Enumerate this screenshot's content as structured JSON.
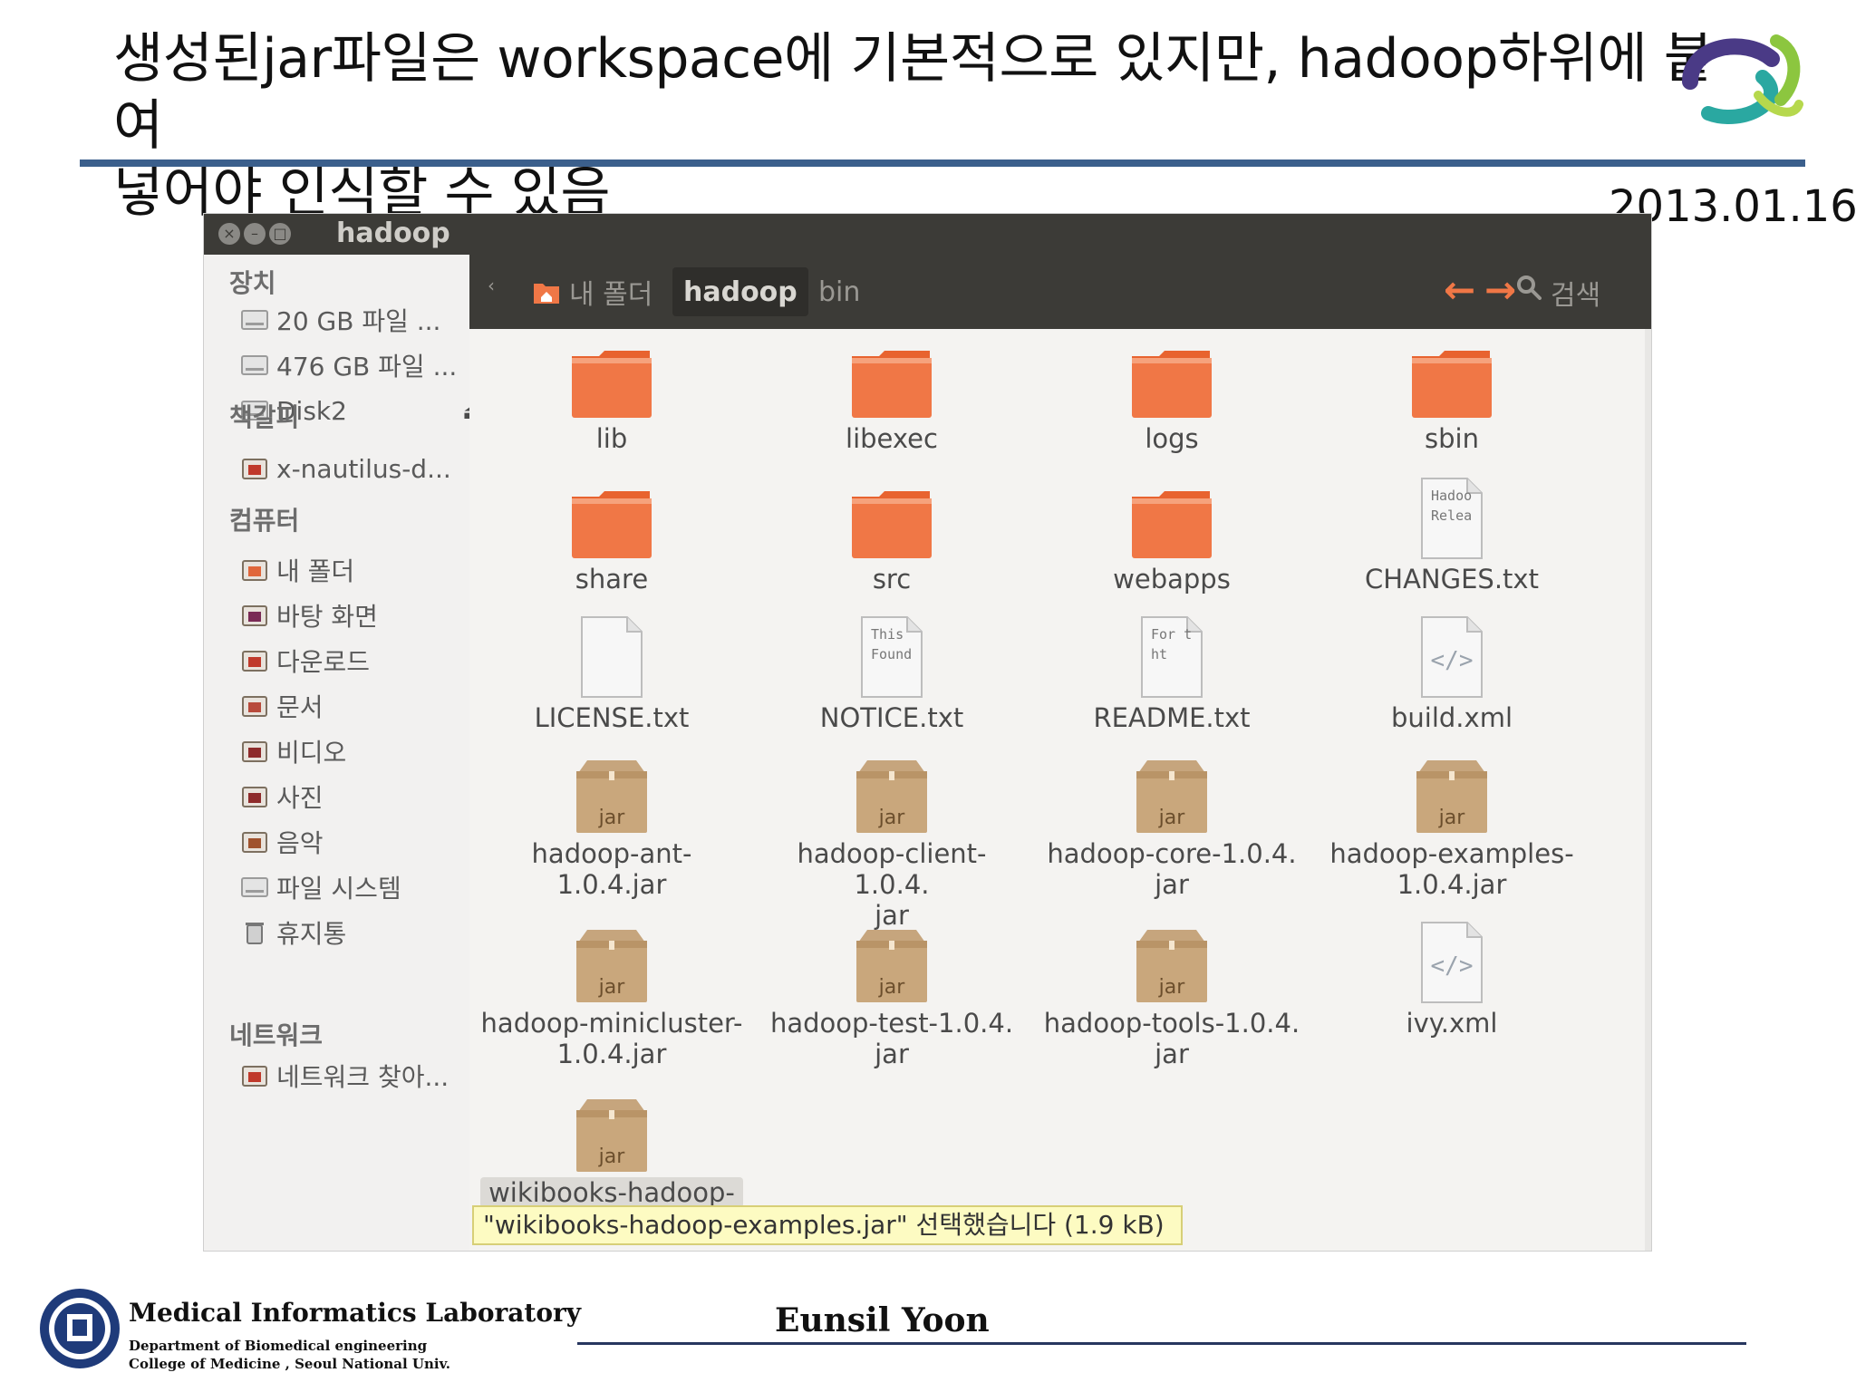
{
  "slide": {
    "title_line1": "생성된jar파일은 workspace에 기본적으로 있지만, hadoop하위에 붙여",
    "title_line2": "넣어야 인식할 수 있음",
    "date": "2013.01.16"
  },
  "window": {
    "title": "hadoop",
    "buttons": [
      "close",
      "minimize",
      "maximize"
    ]
  },
  "toolbar": {
    "breadcrumbs": [
      "내 폴더",
      "hadoop",
      "bin"
    ],
    "active_crumb": "hadoop",
    "back_icon": "arrow-left-icon",
    "forward_icon": "arrow-right-icon",
    "search_label": "검색"
  },
  "sidebar": {
    "sections": [
      {
        "heading": "장치",
        "items": [
          {
            "label": "20 GB 파일 ...",
            "icon": "drive-icon"
          },
          {
            "label": "476 GB 파일 ...",
            "icon": "drive-icon"
          },
          {
            "label": "Disk2",
            "icon": "drive-icon"
          }
        ]
      },
      {
        "heading": "책갈피",
        "items": [
          {
            "label": "x-nautilus-d...",
            "icon": "folder-icon"
          }
        ]
      },
      {
        "heading": "컴퓨터",
        "items": [
          {
            "label": "내 폴더",
            "icon": "home-icon"
          },
          {
            "label": "바탕 화면",
            "icon": "desktop-icon"
          },
          {
            "label": "다운로드",
            "icon": "downloads-icon"
          },
          {
            "label": "문서",
            "icon": "documents-icon"
          },
          {
            "label": "비디오",
            "icon": "videos-icon"
          },
          {
            "label": "사진",
            "icon": "pictures-icon"
          },
          {
            "label": "음악",
            "icon": "music-icon"
          },
          {
            "label": "파일 시스템",
            "icon": "filesystem-icon"
          },
          {
            "label": "휴지통",
            "icon": "trash-icon"
          }
        ]
      },
      {
        "heading": "네트워크",
        "items": [
          {
            "label": "네트워크 찾아...",
            "icon": "network-icon"
          }
        ]
      }
    ]
  },
  "files": [
    {
      "name": "lib",
      "type": "folder"
    },
    {
      "name": "libexec",
      "type": "folder"
    },
    {
      "name": "logs",
      "type": "folder"
    },
    {
      "name": "sbin",
      "type": "folder"
    },
    {
      "name": "share",
      "type": "folder"
    },
    {
      "name": "src",
      "type": "folder"
    },
    {
      "name": "webapps",
      "type": "folder"
    },
    {
      "name": "CHANGES.txt",
      "type": "text",
      "preview": [
        "Hadoo",
        "Relea"
      ]
    },
    {
      "name": "LICENSE.txt",
      "type": "text",
      "preview": []
    },
    {
      "name": "NOTICE.txt",
      "type": "text",
      "preview": [
        "This",
        "Found"
      ]
    },
    {
      "name": "README.txt",
      "type": "text",
      "preview": [
        "For t",
        "ht"
      ]
    },
    {
      "name": "build.xml",
      "type": "xml"
    },
    {
      "name": "hadoop-ant-1.0.4.jar",
      "type": "jar"
    },
    {
      "name": "hadoop-client-1.0.4.\njar",
      "type": "jar"
    },
    {
      "name": "hadoop-core-1.0.4.\njar",
      "type": "jar"
    },
    {
      "name": "hadoop-examples-\n1.0.4.jar",
      "type": "jar"
    },
    {
      "name": "hadoop-minicluster-\n1.0.4.jar",
      "type": "jar"
    },
    {
      "name": "hadoop-test-1.0.4.\njar",
      "type": "jar"
    },
    {
      "name": "hadoop-tools-1.0.4.\njar",
      "type": "jar"
    },
    {
      "name": "ivy.xml",
      "type": "xml"
    },
    {
      "name": "wikibooks-hadoop-",
      "type": "jar",
      "selected": true
    }
  ],
  "jar_badge": "jar",
  "status": "\"wikibooks-hadoop-examples.jar\" 선택했습니다 (1.9 kB)",
  "footer": {
    "lab_name": "Medical  Informatics Laboratory",
    "lab_sub1": "Department of Biomedical engineering",
    "lab_sub2": "College of Medicine , Seoul  National  Univ.",
    "author": "Eunsil Yoon"
  },
  "colors": {
    "folder": "#f07746",
    "title_rule": "#3b5f8c",
    "toolbar_bg": "#3c3b37",
    "status_bg": "#fdfbc2"
  }
}
